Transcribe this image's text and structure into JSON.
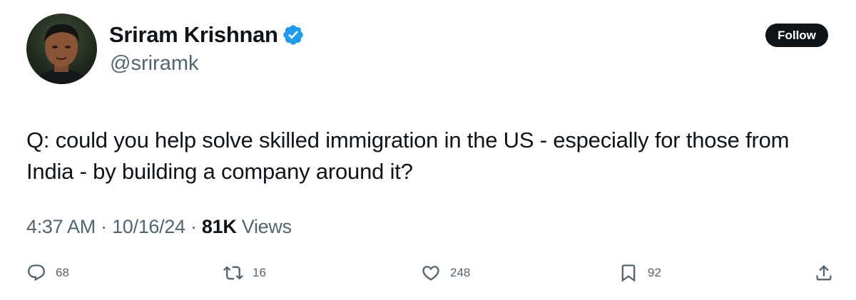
{
  "author": {
    "display_name": "Sriram Krishnan",
    "handle": "@sriramk",
    "verified": true
  },
  "follow_label": "Follow",
  "tweet_text": "Q: could you help solve skilled immigration in the US - especially for those from India - by building a company around it?",
  "meta": {
    "time": "4:37 AM",
    "separator": "·",
    "date": "10/16/24",
    "views_count": "81K",
    "views_label": "Views"
  },
  "actions": {
    "replies": "68",
    "reposts": "16",
    "likes": "248",
    "bookmarks": "92"
  },
  "icons": {
    "verified": "verified-badge-icon",
    "reply": "reply-icon",
    "repost": "repost-icon",
    "like": "heart-icon",
    "bookmark": "bookmark-icon",
    "share": "share-icon"
  },
  "colors": {
    "text_primary": "#0f1419",
    "text_secondary": "#536471",
    "verified_blue": "#1d9bf0",
    "follow_bg": "#0f1419"
  }
}
